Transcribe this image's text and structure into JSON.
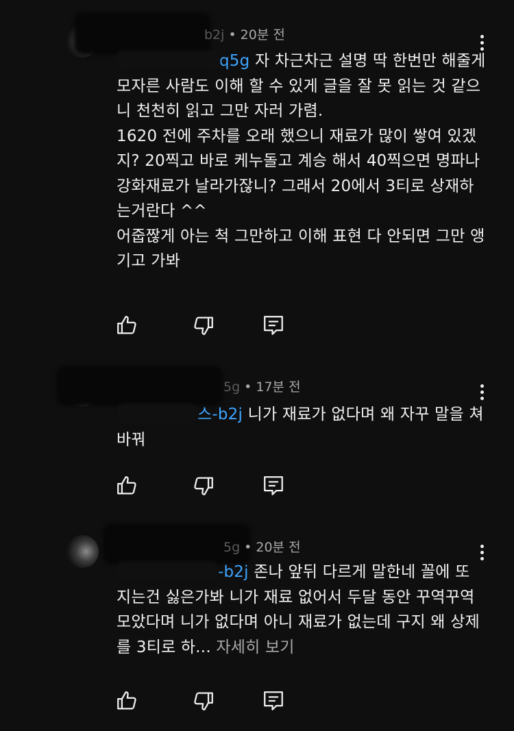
{
  "comments": [
    {
      "handle_tail": "b2j",
      "time": "20분 전",
      "mention_tail": "q5g",
      "text": " 자 차근차근 설명 딱 한번만 해줄게 모자른 사람도 이해 할 수 있게 글을 잘 못 읽는 것 같으니 천천히 읽고 그만 자러 가렴.\n1620 전에 주차를 오래 했으니 재료가 많이 쌓여 있겠지? 20찍고 바로 케누돌고 계승 해서 40찍으면 명파나 강화재료가 날라가잖니? 그래서 20에서 3티로 상재하는거란다 ^^\n어줍짢게 아는 척 그만하고 이해 표현 다 안되면 그만 앵기고 가봐",
      "read_more": ""
    },
    {
      "handle_tail": "5g",
      "time": "17분 전",
      "mention_tail": "스-b2j",
      "text": " 니가 재료가 없다며 왜 자꾸 말을 쳐 바꿔",
      "read_more": ""
    },
    {
      "handle_tail": "5g",
      "time": "20분 전",
      "mention_tail": "-b2j",
      "text": " 존나 앞뒤 다르게 말한네 꼴에 또 지는건 싫은가봐 니가 재료 없어서 두달 동안 꾸역꾸역 모았다며 니가 없다며 아니 재료가 없는데 구지 왜 상제를 3티로 하...",
      "read_more": "자세히 보기"
    }
  ],
  "icons": {
    "like": "thumbs-up-icon",
    "dislike": "thumbs-down-icon",
    "reply": "reply-icon",
    "more": "vertical-dots-icon"
  }
}
